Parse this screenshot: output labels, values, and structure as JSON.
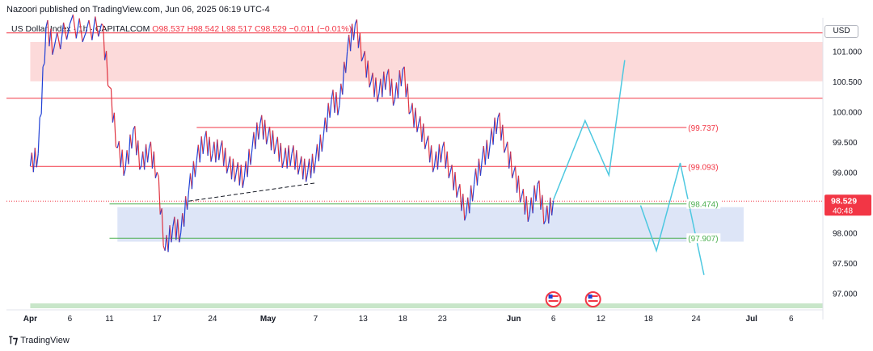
{
  "header": {
    "published": "Nazoori published on TradingView.com, Jun 06, 2025 06:19 UTC-4",
    "symbol": "US Dollar Index · 1h · CAPITALCOM",
    "open": "O98.537",
    "high": "H98.542",
    "low": "L98.517",
    "close": "C98.529",
    "change": "−0.011 (−0.01%)"
  },
  "axis": {
    "currency": "USD"
  },
  "footer": {
    "brand": "TradingView"
  },
  "chart_data": {
    "type": "line",
    "title": "US Dollar Index · 1h · CAPITALCOM",
    "ylim": [
      96.75,
      101.55
    ],
    "y_ticks": [
      97.0,
      97.5,
      98.0,
      98.5,
      99.0,
      99.5,
      100.0,
      100.5,
      101.0
    ],
    "y_tick_labels": [
      "97.000",
      "97.500",
      "98.000",
      "98.500",
      "99.000",
      "99.500",
      "100.000",
      "100.500",
      "101.000"
    ],
    "x_tick_labels": [
      "Apr",
      "6",
      "11",
      "17",
      "24",
      "May",
      "7",
      "13",
      "18",
      "23",
      "Jun",
      "6",
      "12",
      "18",
      "24",
      "Jul",
      "6"
    ],
    "x_tick_dates": [
      "2025-04-01",
      "2025-04-06",
      "2025-04-11",
      "2025-04-17",
      "2025-04-24",
      "2025-05-01",
      "2025-05-07",
      "2025-05-13",
      "2025-05-18",
      "2025-05-23",
      "2025-06-01",
      "2025-06-06",
      "2025-06-12",
      "2025-06-18",
      "2025-06-24",
      "2025-07-01",
      "2025-07-06"
    ],
    "last_price": {
      "value": "98.529",
      "countdown": "40:48",
      "color": "#f23645"
    },
    "price_path": [
      [
        "2025-04-01",
        99.1
      ],
      [
        "2025-04-02",
        99.3
      ],
      [
        "2025-04-03",
        101.4
      ],
      [
        "2025-04-04",
        101.05
      ],
      [
        "2025-04-06",
        101.45
      ],
      [
        "2025-04-08",
        101.3
      ],
      [
        "2025-04-10",
        101.45
      ],
      [
        "2025-04-11",
        100.4
      ],
      [
        "2025-04-12",
        99.4
      ],
      [
        "2025-04-13",
        99.05
      ],
      [
        "2025-04-14",
        99.7
      ],
      [
        "2025-04-15",
        99.1
      ],
      [
        "2025-04-16",
        99.4
      ],
      [
        "2025-04-17",
        99.0
      ],
      [
        "2025-04-18",
        97.7
      ],
      [
        "2025-04-19",
        98.1
      ],
      [
        "2025-04-20",
        98.0
      ],
      [
        "2025-04-21",
        98.7
      ],
      [
        "2025-04-22",
        99.2
      ],
      [
        "2025-04-23",
        99.55
      ],
      [
        "2025-04-24",
        99.3
      ],
      [
        "2025-04-25",
        99.4
      ],
      [
        "2025-04-26",
        99.1
      ],
      [
        "2025-04-27",
        99.0
      ],
      [
        "2025-04-28",
        98.9
      ],
      [
        "2025-04-29",
        99.4
      ],
      [
        "2025-04-30",
        99.8
      ],
      [
        "2025-05-01",
        99.6
      ],
      [
        "2025-05-02",
        99.45
      ],
      [
        "2025-05-03",
        99.2
      ],
      [
        "2025-05-04",
        99.3
      ],
      [
        "2025-05-05",
        99.1
      ],
      [
        "2025-05-06",
        99.0
      ],
      [
        "2025-05-07",
        99.2
      ],
      [
        "2025-05-08",
        99.6
      ],
      [
        "2025-05-09",
        100.2
      ],
      [
        "2025-05-10",
        100.1
      ],
      [
        "2025-05-11",
        101.0
      ],
      [
        "2025-05-12",
        101.45
      ],
      [
        "2025-05-13",
        100.9
      ],
      [
        "2025-05-14",
        100.5
      ],
      [
        "2025-05-15",
        100.3
      ],
      [
        "2025-05-16",
        100.6
      ],
      [
        "2025-05-17",
        100.2
      ],
      [
        "2025-05-18",
        100.7
      ],
      [
        "2025-05-19",
        100.0
      ],
      [
        "2025-05-20",
        99.8
      ],
      [
        "2025-05-21",
        99.5
      ],
      [
        "2025-05-22",
        99.1
      ],
      [
        "2025-05-23",
        99.4
      ],
      [
        "2025-05-24",
        99.0
      ],
      [
        "2025-05-25",
        98.7
      ],
      [
        "2025-05-26",
        98.3
      ],
      [
        "2025-05-27",
        98.8
      ],
      [
        "2025-05-28",
        99.2
      ],
      [
        "2025-05-29",
        99.45
      ],
      [
        "2025-05-30",
        99.9
      ],
      [
        "2025-05-31",
        99.4
      ],
      [
        "2025-06-01",
        99.0
      ],
      [
        "2025-06-02",
        98.6
      ],
      [
        "2025-06-03",
        98.3
      ],
      [
        "2025-06-04",
        98.8
      ],
      [
        "2025-06-05",
        98.2
      ],
      [
        "2025-06-06",
        98.53
      ]
    ],
    "projection_paths": [
      {
        "color": "#4dc8e0",
        "points": [
          [
            "2025-06-06",
            98.54
          ],
          [
            "2025-06-10",
            99.85
          ],
          [
            "2025-06-13",
            98.95
          ],
          [
            "2025-06-15",
            100.85
          ]
        ]
      },
      {
        "color": "#4dc8e0",
        "points": [
          [
            "2025-06-17",
            98.45
          ],
          [
            "2025-06-19",
            97.7
          ],
          [
            "2025-06-22",
            99.15
          ],
          [
            "2025-06-25",
            97.3
          ]
        ]
      }
    ],
    "levels": [
      {
        "label": "(99.737)",
        "value": 99.737,
        "color": "#f23645",
        "start": "2025-04-22",
        "end": "2025-06-27"
      },
      {
        "label": "(99.093)",
        "value": 99.093,
        "color": "#f23645",
        "start": "2025-04-01",
        "end": "2025-06-27"
      },
      {
        "label": "(98.474)",
        "value": 98.474,
        "color": "#4caf50",
        "start": "2025-04-11",
        "end": "2025-06-27"
      },
      {
        "label": "(97.907)",
        "value": 97.907,
        "color": "#4caf50",
        "start": "2025-04-11",
        "end": "2025-06-27"
      }
    ],
    "full_width_lines": [
      {
        "value": 101.3,
        "color": "#f23645"
      },
      {
        "value": 100.22,
        "color": "#f23645"
      },
      {
        "value": 98.52,
        "color": "#f23645",
        "dotted": true
      }
    ],
    "zones": [
      {
        "from": 100.5,
        "to": 101.15,
        "color": "#fcdada",
        "start": "2025-04-01",
        "end": "2025-07-10"
      },
      {
        "from": 97.85,
        "to": 98.42,
        "color": "#dde5f7",
        "start": "2025-04-12",
        "end": "2025-06-30"
      },
      {
        "from": 96.75,
        "to": 96.83,
        "color": "#c8e6c9",
        "start": "2025-04-01",
        "end": "2025-07-10"
      }
    ],
    "trendline": {
      "color": "#131722",
      "points": [
        [
          "2025-04-21",
          98.52
        ],
        [
          "2025-05-07",
          98.82
        ]
      ]
    },
    "event_markers": [
      "2025-06-06",
      "2025-06-11"
    ]
  }
}
